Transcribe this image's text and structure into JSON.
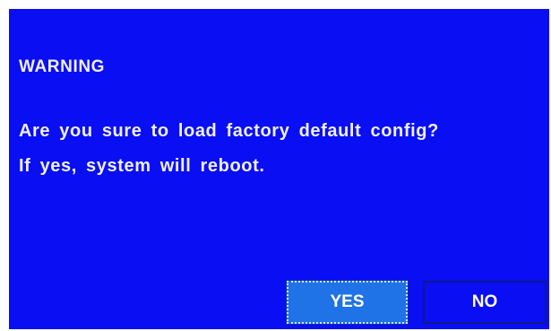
{
  "dialog": {
    "title": "WARNING",
    "message_line1": "Are you sure to load factory default config?",
    "message_line2": "If yes, system will reboot.",
    "buttons": {
      "yes_label": "YES",
      "no_label": "NO"
    }
  },
  "colors": {
    "background": "#0a0ef2",
    "selected_button": "#1f73e6",
    "text": "#eef0ff"
  }
}
